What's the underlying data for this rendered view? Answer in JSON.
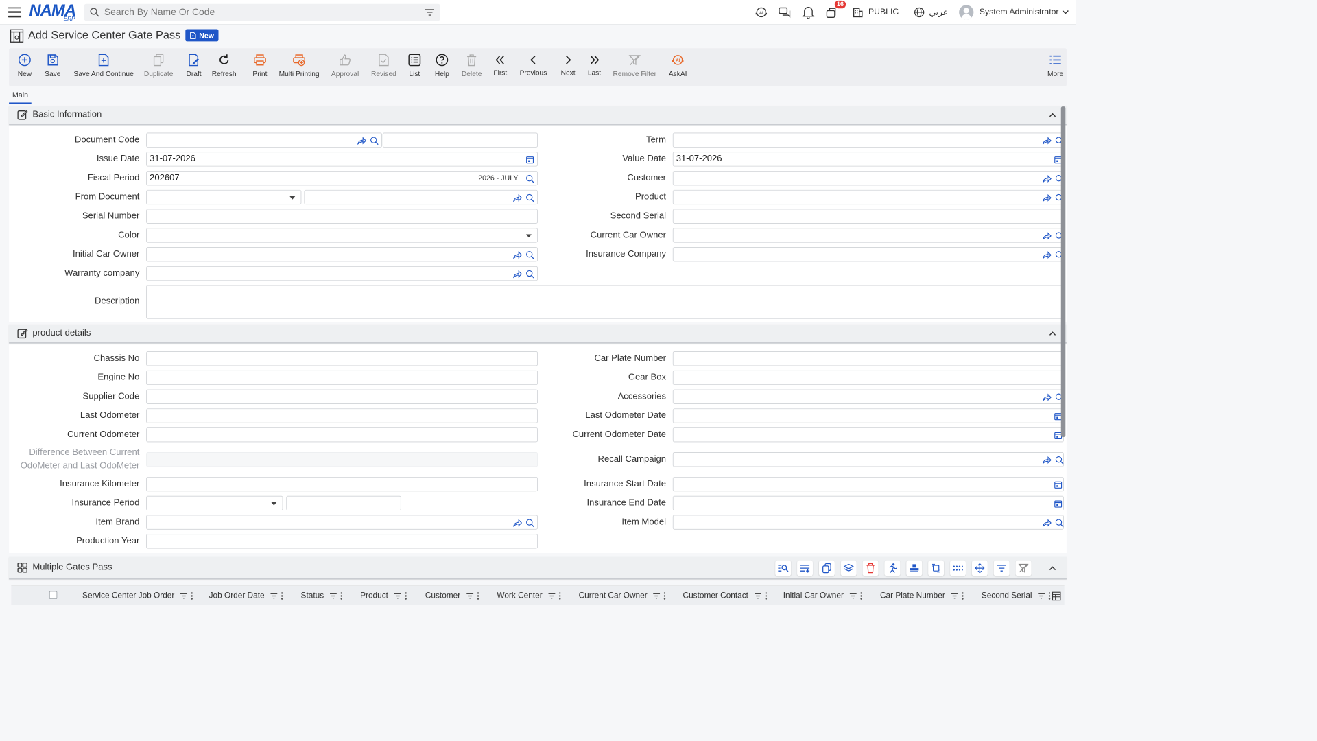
{
  "topbar": {
    "search_placeholder": "Search By Name Or Code",
    "logo_main": "NAMA",
    "logo_sub": "ERP",
    "notification_count": "16",
    "branch": "PUBLIC",
    "language": "عربي",
    "user": "System Administrator"
  },
  "page": {
    "title": "Add Service Center Gate Pass",
    "status_badge": "New"
  },
  "toolbar": {
    "new": "New",
    "save": "Save",
    "save_continue": "Save And Continue",
    "duplicate": "Duplicate",
    "draft": "Draft",
    "refresh": "Refresh",
    "print": "Print",
    "multi_printing": "Multi Printing",
    "approval": "Approval",
    "revised": "Revised",
    "list": "List",
    "help": "Help",
    "delete": "Delete",
    "first": "First",
    "previous": "Previous",
    "next": "Next",
    "last": "Last",
    "remove_filter": "Remove Filter",
    "askai": "AskAI",
    "more": "More"
  },
  "tabs": {
    "main": "Main"
  },
  "basic": {
    "title": "Basic Information",
    "document_code": "Document Code",
    "term": "Term",
    "issue_date": "Issue Date",
    "issue_date_value": "31-07-2026",
    "value_date": "Value Date",
    "value_date_value": "31-07-2026",
    "fiscal_period": "Fiscal Period",
    "fiscal_period_value": "202607",
    "fiscal_period_name": "2026 - JULY",
    "customer": "Customer",
    "from_document": "From Document",
    "product": "Product",
    "serial_number": "Serial Number",
    "second_serial": "Second Serial",
    "color": "Color",
    "current_car_owner": "Current Car Owner",
    "initial_car_owner": "Initial Car Owner",
    "insurance_company": "Insurance Company",
    "warranty_company": "Warranty company",
    "description": "Description"
  },
  "product": {
    "title": "product details",
    "chassis_no": "Chassis No",
    "car_plate_number": "Car Plate Number",
    "engine_no": "Engine No",
    "gear_box": "Gear Box",
    "supplier_code": "Supplier Code",
    "accessories": "Accessories",
    "last_odometer": "Last Odometer",
    "last_odometer_date": "Last Odometer Date",
    "current_odometer": "Current Odometer",
    "current_odometer_date": "Current Odometer Date",
    "difference_odometer": "Difference Between Current OdoMeter and Last OdoMeter",
    "recall_campaign": "Recall Campaign",
    "insurance_kilometer": "Insurance Kilometer",
    "insurance_start_date": "Insurance Start Date",
    "insurance_period": "Insurance Period",
    "insurance_end_date": "Insurance End Date",
    "item_brand": "Item Brand",
    "item_model": "Item Model",
    "production_year": "Production Year"
  },
  "grid": {
    "title": "Multiple Gates Pass",
    "columns": [
      "Service Center Job Order",
      "Job Order Date",
      "Status",
      "Product",
      "Customer",
      "Work Center",
      "Current Car Owner",
      "Customer Contact",
      "Initial Car Owner",
      "Car Plate Number",
      "Second Serial"
    ]
  },
  "colors": {
    "primary": "#1f56c7",
    "print_orange": "#e8692b",
    "askai_orange": "#e8692b"
  }
}
